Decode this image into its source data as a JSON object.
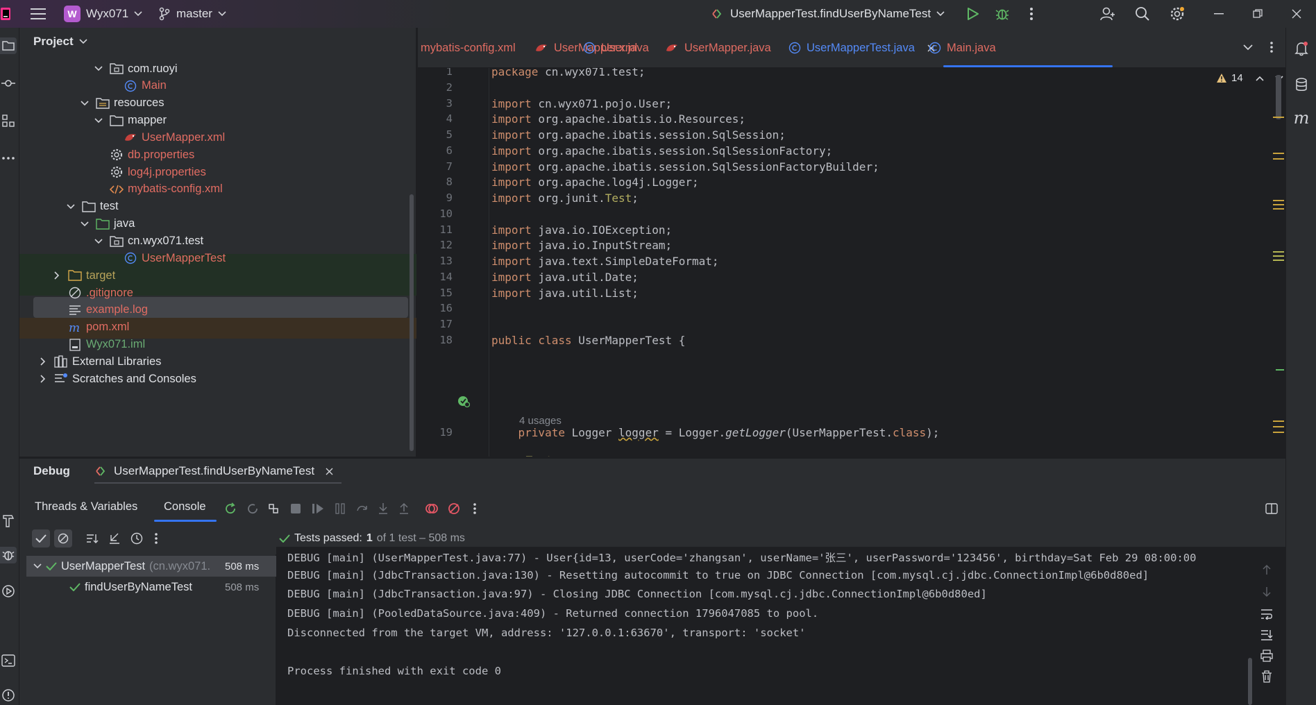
{
  "titlebar": {
    "project_initial": "W",
    "project_name": "Wyx071",
    "branch": "master",
    "run_config": "UserMapperTest.findUserByNameTest"
  },
  "project_panel": {
    "title": "Project",
    "tree": [
      {
        "label": "com.ruoyi",
        "indent": 4,
        "chev": "down",
        "icon": "package-icon",
        "color": "white"
      },
      {
        "label": "Main",
        "indent": 5,
        "chev": "",
        "icon": "class-icon",
        "color": "red"
      },
      {
        "label": "resources",
        "indent": 3,
        "chev": "down",
        "icon": "resources-folder-icon",
        "color": "white"
      },
      {
        "label": "mapper",
        "indent": 4,
        "chev": "down",
        "icon": "folder-icon",
        "color": "white"
      },
      {
        "label": "UserMapper.xml",
        "indent": 5,
        "chev": "",
        "icon": "mybatis-icon",
        "color": "red"
      },
      {
        "label": "db.properties",
        "indent": 4,
        "chev": "",
        "icon": "properties-icon",
        "color": "red"
      },
      {
        "label": "log4j.properties",
        "indent": 4,
        "chev": "",
        "icon": "properties-icon",
        "color": "red"
      },
      {
        "label": "mybatis-config.xml",
        "indent": 4,
        "chev": "",
        "icon": "xml-icon",
        "color": "red"
      },
      {
        "label": "test",
        "indent": 2,
        "chev": "down",
        "icon": "folder-icon",
        "color": "white"
      },
      {
        "label": "java",
        "indent": 3,
        "chev": "down",
        "icon": "test-folder-icon",
        "color": "white"
      },
      {
        "label": "cn.wyx071.test",
        "indent": 4,
        "chev": "down",
        "icon": "package-icon",
        "color": "white"
      },
      {
        "label": "UserMapperTest",
        "indent": 5,
        "chev": "",
        "icon": "class-icon",
        "color": "red"
      },
      {
        "label": "target",
        "indent": 1,
        "chev": "right",
        "icon": "excluded-folder-icon",
        "color": "olive"
      },
      {
        "label": ".gitignore",
        "indent": 1,
        "chev": "",
        "icon": "ignore-icon",
        "color": "red"
      },
      {
        "label": "example.log",
        "indent": 1,
        "chev": "",
        "icon": "text-file-icon",
        "color": "red"
      },
      {
        "label": "pom.xml",
        "indent": 1,
        "chev": "",
        "icon": "maven-icon",
        "color": "red"
      },
      {
        "label": "Wyx071.iml",
        "indent": 1,
        "chev": "",
        "icon": "iml-file-icon",
        "color": "green"
      },
      {
        "label": "External Libraries",
        "indent": 0,
        "chev": "right",
        "icon": "library-icon",
        "color": "white"
      },
      {
        "label": "Scratches and Consoles",
        "indent": 0,
        "chev": "right",
        "icon": "scratches-icon",
        "color": "white"
      }
    ]
  },
  "editor": {
    "tabs": [
      {
        "label": "mybatis-config.xml",
        "icon": "xml-icon"
      },
      {
        "label": "UserMapper.xml",
        "icon": "mybatis-icon"
      },
      {
        "label": "User.java",
        "icon": "class-icon"
      },
      {
        "label": "UserMapper.java",
        "icon": "mybatis-icon"
      },
      {
        "label": "UserMapperTest.java",
        "icon": "class-icon"
      },
      {
        "label": "Main.java",
        "icon": "class-icon"
      }
    ],
    "warnings_count": "14",
    "usage_hint": "4 usages",
    "lines": [
      {
        "n": "1",
        "code": "package cn.wyx071.test;"
      },
      {
        "n": "2",
        "code": ""
      },
      {
        "n": "3",
        "code": "import cn.wyx071.pojo.User;"
      },
      {
        "n": "4",
        "code": "import org.apache.ibatis.io.Resources;"
      },
      {
        "n": "5",
        "code": "import org.apache.ibatis.session.SqlSession;"
      },
      {
        "n": "6",
        "code": "import org.apache.ibatis.session.SqlSessionFactory;"
      },
      {
        "n": "7",
        "code": "import org.apache.ibatis.session.SqlSessionFactoryBuilder;"
      },
      {
        "n": "8",
        "code": "import org.apache.log4j.Logger;"
      },
      {
        "n": "9",
        "code": "import org.junit.Test;"
      },
      {
        "n": "10",
        "code": ""
      },
      {
        "n": "11",
        "code": "import java.io.IOException;"
      },
      {
        "n": "12",
        "code": "import java.io.InputStream;"
      },
      {
        "n": "13",
        "code": "import java.text.SimpleDateFormat;"
      },
      {
        "n": "14",
        "code": "import java.util.Date;"
      },
      {
        "n": "15",
        "code": "import java.util.List;"
      },
      {
        "n": "16",
        "code": ""
      },
      {
        "n": "17",
        "code": ""
      },
      {
        "n": "18",
        "code": "public class UserMapperTest {"
      },
      {
        "n": "19",
        "code": "    private Logger logger = Logger.getLogger(UserMapperTest.class);"
      }
    ]
  },
  "debug": {
    "title": "Debug",
    "session_tab": "UserMapperTest.findUserByNameTest",
    "sub_tabs": [
      "Threads & Variables",
      "Console"
    ],
    "tests_passed_label": "Tests passed:",
    "tests_passed_count": "1",
    "tests_passed_rest": "of 1 test – 508 ms",
    "tree": [
      {
        "label": "UserMapperTest",
        "detail": "(cn.wyx071.",
        "time": "508 ms"
      },
      {
        "label": "findUserByNameTest",
        "detail": "",
        "time": "508 ms"
      }
    ],
    "console_lines": [
      "DEBUG [main] (UserMapperTest.java:77) - User{id=13, userCode='zhangsan', userName='张三', userPassword='123456', birthday=Sat Feb 29 08:00:00",
      "DEBUG [main] (JdbcTransaction.java:130) - Resetting autocommit to true on JDBC Connection [com.mysql.cj.jdbc.ConnectionImpl@6b0d80ed]",
      "DEBUG [main] (JdbcTransaction.java:97) - Closing JDBC Connection [com.mysql.cj.jdbc.ConnectionImpl@6b0d80ed]",
      "DEBUG [main] (PooledDataSource.java:409) - Returned connection 1796047085 to pool.",
      "Disconnected from the target VM, address: '127.0.0.1:63670', transport: 'socket'",
      "",
      "Process finished with exit code 0"
    ]
  },
  "colors": {
    "accent": "#3574f0",
    "file_error_red": "#e06c62",
    "pass_green": "#5fb865",
    "warning_yellow": "#e5c07b"
  }
}
